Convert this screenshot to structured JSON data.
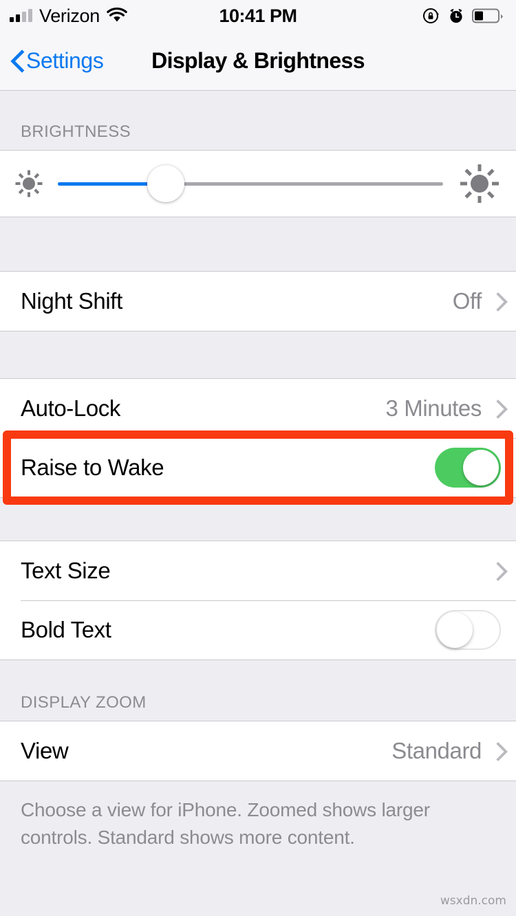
{
  "status_bar": {
    "carrier": "Verizon",
    "time": "10:41 PM",
    "signal_icon": "cellular-signal-icon",
    "wifi_icon": "wifi-icon",
    "rotation_lock_icon": "rotation-lock-icon",
    "alarm_icon": "alarm-clock-icon",
    "battery_icon": "battery-icon",
    "battery_level_pct": 35
  },
  "nav": {
    "back_label": "Settings",
    "title": "Display & Brightness",
    "back_icon": "chevron-left-icon",
    "tint_color": "#0b79ef"
  },
  "sections": {
    "brightness": {
      "header": "BRIGHTNESS",
      "slider": {
        "value_pct": 28,
        "min_icon": "sun-small-icon",
        "max_icon": "sun-large-icon",
        "fill_color": "#0b79ef",
        "track_color": "#a7a7ac"
      }
    },
    "night_shift": {
      "rows": [
        {
          "label": "Night Shift",
          "value": "Off",
          "accessory": "chevron-right-icon"
        }
      ]
    },
    "lock": {
      "rows": [
        {
          "label": "Auto-Lock",
          "value": "3 Minutes",
          "accessory": "chevron-right-icon"
        },
        {
          "label": "Raise to Wake",
          "toggle": "on",
          "toggle_color": "#4ccc60"
        }
      ]
    },
    "text": {
      "rows": [
        {
          "label": "Text Size",
          "value": "",
          "accessory": "chevron-right-icon"
        },
        {
          "label": "Bold Text",
          "toggle": "off"
        }
      ]
    },
    "display_zoom": {
      "header": "DISPLAY ZOOM",
      "rows": [
        {
          "label": "View",
          "value": "Standard",
          "accessory": "chevron-right-icon"
        }
      ],
      "footer": "Choose a view for iPhone. Zoomed shows larger controls. Standard shows more content."
    }
  },
  "annotation": {
    "highlight_color": "#f93a10",
    "highlights_row": "Raise to Wake"
  },
  "watermark": "wsxdn.com"
}
